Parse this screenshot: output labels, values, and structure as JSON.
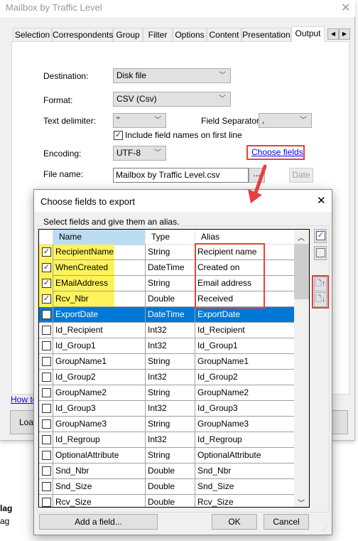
{
  "window": {
    "title": "Mailbox by Traffic Level"
  },
  "tabs": [
    {
      "label": "Selection"
    },
    {
      "label": "Correspondents"
    },
    {
      "label": "Group"
    },
    {
      "label": "Filter"
    },
    {
      "label": "Options"
    },
    {
      "label": "Content"
    },
    {
      "label": "Presentation"
    },
    {
      "label": "Output",
      "selected": true
    }
  ],
  "output": {
    "destination_label": "Destination:",
    "destination": "Disk file",
    "format_label": "Format:",
    "format": "CSV (Csv)",
    "text_delimiter_label": "Text delimiter:",
    "text_delimiter": "\"",
    "field_separator_label": "Field Separator:",
    "field_separator": ",",
    "include_names_label": "Include field names on first line",
    "include_names_checked": true,
    "encoding_label": "Encoding:",
    "encoding": "UTF-8",
    "choose_fields_link": "Choose fields",
    "file_name_label": "File name:",
    "file_name": "Mailbox by Traffic Level.csv",
    "browse_label": "...",
    "date_label": "Date",
    "how_to_link": "How to",
    "load_button": "Load"
  },
  "background_text": [
    "lag",
    "ag"
  ],
  "dialog": {
    "title": "Choose fields to export",
    "group_label": "Select fields and give them an alias.",
    "columns": [
      "Name",
      "Type",
      "Alias"
    ],
    "rows": [
      {
        "checked": true,
        "name": "RecipientName",
        "type": "String",
        "alias": "Recipient name"
      },
      {
        "checked": true,
        "name": "WhenCreated",
        "type": "DateTime",
        "alias": "Created on"
      },
      {
        "checked": true,
        "name": "EMailAddress",
        "type": "String",
        "alias": "Email address"
      },
      {
        "checked": true,
        "name": "Rcv_Nbr",
        "type": "Double",
        "alias": "Received"
      },
      {
        "checked": false,
        "name": "ExportDate",
        "type": "DateTime",
        "alias": "ExportDate",
        "selected": true
      },
      {
        "checked": false,
        "name": "Id_Recipient",
        "type": "Int32",
        "alias": "Id_Recipient"
      },
      {
        "checked": false,
        "name": "Id_Group1",
        "type": "Int32",
        "alias": "Id_Group1"
      },
      {
        "checked": false,
        "name": "GroupName1",
        "type": "String",
        "alias": "GroupName1"
      },
      {
        "checked": false,
        "name": "Id_Group2",
        "type": "Int32",
        "alias": "Id_Group2"
      },
      {
        "checked": false,
        "name": "GroupName2",
        "type": "String",
        "alias": "GroupName2"
      },
      {
        "checked": false,
        "name": "Id_Group3",
        "type": "Int32",
        "alias": "Id_Group3"
      },
      {
        "checked": false,
        "name": "GroupName3",
        "type": "String",
        "alias": "GroupName3"
      },
      {
        "checked": false,
        "name": "Id_Regroup",
        "type": "Int32",
        "alias": "Id_Regroup"
      },
      {
        "checked": false,
        "name": "OptionalAttribute",
        "type": "String",
        "alias": "OptionalAttribute"
      },
      {
        "checked": false,
        "name": "Snd_Nbr",
        "type": "Double",
        "alias": "Snd_Nbr"
      },
      {
        "checked": false,
        "name": "Snd_Size",
        "type": "Double",
        "alias": "Snd_Size"
      },
      {
        "checked": false,
        "name": "Rcv_Size",
        "type": "Double",
        "alias": "Rcv_Size"
      }
    ],
    "add_field_button": "Add a field...",
    "ok_button": "OK",
    "cancel_button": "Cancel"
  },
  "colors": {
    "highlight": "#fff35c",
    "annotation": "#e8403f",
    "selection": "#0078d7",
    "header_sorted": "#bcdcf4"
  }
}
